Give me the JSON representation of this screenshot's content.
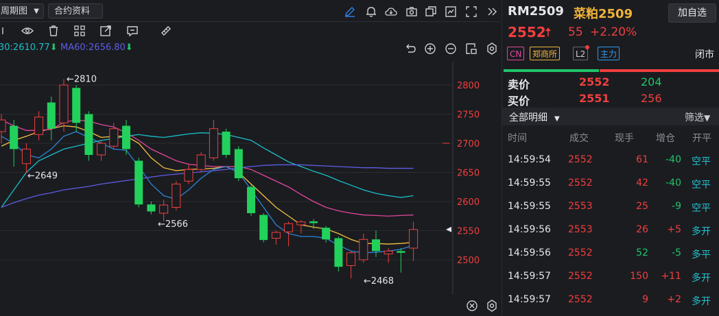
{
  "toolbar": {
    "period_label": "周期图",
    "contract_info_label": "合约资料"
  },
  "ma": {
    "ma30_label": "30:2610.77",
    "ma60_label": "MA60:2656.80"
  },
  "chart_data": {
    "type": "candlestick",
    "y_ticks": [
      2800,
      2750,
      2700,
      2650,
      2600,
      2550,
      2500
    ],
    "ylim": [
      2440,
      2840
    ],
    "last_price_marker": 2552,
    "annotations": [
      {
        "text": "←2810",
        "value": 2810
      },
      {
        "text": "←2649",
        "value": 2649
      },
      {
        "text": "←2566",
        "value": 2566
      },
      {
        "text": "←2468",
        "value": 2468
      }
    ],
    "candles": [
      {
        "o": 2720,
        "c": 2740,
        "h": 2750,
        "l": 2700
      },
      {
        "o": 2730,
        "c": 2690,
        "h": 2740,
        "l": 2660
      },
      {
        "o": 2665,
        "c": 2690,
        "h": 2700,
        "l": 2649
      },
      {
        "o": 2715,
        "c": 2745,
        "h": 2755,
        "l": 2705
      },
      {
        "o": 2770,
        "c": 2725,
        "h": 2780,
        "l": 2705
      },
      {
        "o": 2735,
        "c": 2800,
        "h": 2810,
        "l": 2720
      },
      {
        "o": 2795,
        "c": 2735,
        "h": 2800,
        "l": 2720
      },
      {
        "o": 2750,
        "c": 2680,
        "h": 2755,
        "l": 2670
      },
      {
        "o": 2680,
        "c": 2700,
        "h": 2705,
        "l": 2670
      },
      {
        "o": 2695,
        "c": 2725,
        "h": 2735,
        "l": 2690
      },
      {
        "o": 2730,
        "c": 2690,
        "h": 2740,
        "l": 2680
      },
      {
        "o": 2670,
        "c": 2595,
        "h": 2675,
        "l": 2590
      },
      {
        "o": 2595,
        "c": 2583,
        "h": 2600,
        "l": 2578
      },
      {
        "o": 2580,
        "c": 2594,
        "h": 2603,
        "l": 2566
      },
      {
        "o": 2590,
        "c": 2630,
        "h": 2635,
        "l": 2585
      },
      {
        "o": 2635,
        "c": 2655,
        "h": 2665,
        "l": 2630
      },
      {
        "o": 2655,
        "c": 2680,
        "h": 2685,
        "l": 2650
      },
      {
        "o": 2675,
        "c": 2725,
        "h": 2740,
        "l": 2670
      },
      {
        "o": 2720,
        "c": 2680,
        "h": 2725,
        "l": 2675
      },
      {
        "o": 2690,
        "c": 2640,
        "h": 2695,
        "l": 2635
      },
      {
        "o": 2625,
        "c": 2580,
        "h": 2630,
        "l": 2575
      },
      {
        "o": 2577,
        "c": 2534,
        "h": 2580,
        "l": 2530
      },
      {
        "o": 2537,
        "c": 2547,
        "h": 2550,
        "l": 2526
      },
      {
        "o": 2548,
        "c": 2562,
        "h": 2566,
        "l": 2523
      },
      {
        "o": 2560,
        "c": 2565,
        "h": 2568,
        "l": 2545
      },
      {
        "o": 2566,
        "c": 2563,
        "h": 2570,
        "l": 2553
      },
      {
        "o": 2555,
        "c": 2535,
        "h": 2558,
        "l": 2530
      },
      {
        "o": 2537,
        "c": 2488,
        "h": 2540,
        "l": 2480
      },
      {
        "o": 2490,
        "c": 2512,
        "h": 2515,
        "l": 2468
      },
      {
        "o": 2500,
        "c": 2535,
        "h": 2545,
        "l": 2495
      },
      {
        "o": 2535,
        "c": 2515,
        "h": 2550,
        "l": 2505
      },
      {
        "o": 2510,
        "c": 2515,
        "h": 2520,
        "l": 2495
      },
      {
        "o": 2515,
        "c": 2512,
        "h": 2520,
        "l": 2478
      },
      {
        "o": 2520,
        "c": 2552,
        "h": 2565,
        "l": 2498
      }
    ],
    "ma_lines": [
      {
        "color": "#f5c242",
        "points": [
          2695,
          2705,
          2712,
          2720,
          2725,
          2730,
          2728,
          2720,
          2710,
          2712,
          2712,
          2700,
          2675,
          2658,
          2653,
          2655,
          2656,
          2657,
          2660,
          2650,
          2630,
          2610,
          2590,
          2575,
          2560,
          2556,
          2553,
          2545,
          2535,
          2528,
          2528,
          2527,
          2528,
          2530
        ]
      },
      {
        "color": "#e2479b",
        "points": [
          2740,
          2730,
          2722,
          2722,
          2724,
          2736,
          2740,
          2738,
          2732,
          2728,
          2718,
          2705,
          2690,
          2680,
          2670,
          2664,
          2662,
          2660,
          2660,
          2660,
          2655,
          2645,
          2635,
          2625,
          2612,
          2600,
          2590,
          2584,
          2580,
          2577,
          2576,
          2575,
          2576,
          2577
        ]
      },
      {
        "color": "#2a86d6",
        "points": [
          2712,
          2700,
          2680,
          2675,
          2690,
          2712,
          2720,
          2710,
          2700,
          2690,
          2688,
          2660,
          2630,
          2610,
          2604,
          2620,
          2640,
          2655,
          2660,
          2650,
          2620,
          2590,
          2560,
          2545,
          2540,
          2540,
          2537,
          2525,
          2515,
          2512,
          2513,
          2515,
          2518,
          2525
        ]
      },
      {
        "color": "#19c0c9",
        "points": [
          2590,
          2620,
          2650,
          2670,
          2680,
          2690,
          2695,
          2700,
          2705,
          2708,
          2712,
          2715,
          2712,
          2710,
          2713,
          2716,
          2718,
          2717,
          2715,
          2710,
          2705,
          2692,
          2680,
          2668,
          2660,
          2652,
          2645,
          2636,
          2628,
          2620,
          2614,
          2610,
          2607,
          2610
        ]
      },
      {
        "color": "#5e5ce6",
        "points": [
          2590,
          2598,
          2605,
          2611,
          2615,
          2620,
          2623,
          2626,
          2630,
          2633,
          2636,
          2639,
          2642,
          2645,
          2647,
          2649,
          2651,
          2653,
          2655,
          2658,
          2660,
          2662,
          2663,
          2663,
          2663,
          2662,
          2661,
          2660,
          2659,
          2658,
          2658,
          2657,
          2657,
          2657
        ]
      }
    ]
  },
  "quote": {
    "code": "RM2509",
    "name": "菜粕2509",
    "add_watch": "加自选",
    "price": "2552",
    "change": "55",
    "change_pct": "+2.20%",
    "status": "闭市"
  },
  "badges": [
    "CN",
    "郑商所",
    "L2",
    "主力"
  ],
  "orderbook": {
    "sell_label": "卖价",
    "sell_price": "2552",
    "sell_vol": "204",
    "buy_label": "买价",
    "buy_price": "2551",
    "buy_vol": "256"
  },
  "detail": {
    "title": "全部明细",
    "filter": "筛选",
    "columns": [
      "时间",
      "成交",
      "现手",
      "增仓",
      "开平"
    ]
  },
  "trades": [
    {
      "time": "14:59:54",
      "price": "2552",
      "vol": "61",
      "oi": "-40",
      "type": "空平",
      "type_color": "cyan",
      "oi_color": "green"
    },
    {
      "time": "14:59:55",
      "price": "2552",
      "vol": "42",
      "oi": "-40",
      "type": "空平",
      "type_color": "cyan",
      "oi_color": "green"
    },
    {
      "time": "14:59:55",
      "price": "2553",
      "vol": "25",
      "oi": "-9",
      "type": "空平",
      "type_color": "cyan",
      "oi_color": "green"
    },
    {
      "time": "14:59:56",
      "price": "2553",
      "vol": "26",
      "oi": "+5",
      "type": "多开",
      "type_color": "cyan",
      "oi_color": "red"
    },
    {
      "time": "14:59:56",
      "price": "2552",
      "vol": "52",
      "oi": "-5",
      "type": "多平",
      "type_color": "cyan",
      "oi_color": "green"
    },
    {
      "time": "14:59:57",
      "price": "2552",
      "vol": "150",
      "oi": "+11",
      "type": "多开",
      "type_color": "cyan",
      "oi_color": "red"
    },
    {
      "time": "14:59:57",
      "price": "2552",
      "vol": "9",
      "oi": "+2",
      "type": "多开",
      "type_color": "cyan",
      "oi_color": "red"
    }
  ]
}
